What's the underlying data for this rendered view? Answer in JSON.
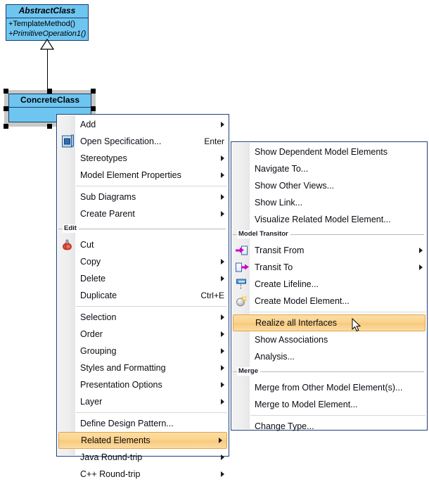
{
  "diagram": {
    "abstract_class": {
      "name": "AbstractClass",
      "operations": [
        "+TemplateMethod()",
        "+PrimitiveOperation1()"
      ]
    },
    "concrete_class": {
      "name": "ConcreteClass",
      "operations": []
    },
    "relationship": "generalization",
    "colors": {
      "class_fill": "#6ec6f0",
      "class_border": "#1b3a6b",
      "selection_frame": "#c8c8c8",
      "handle": "#000000"
    }
  },
  "context_menu": {
    "groups": [
      {
        "label": "",
        "items": [
          {
            "label": "Add",
            "icon": "",
            "accel": "",
            "submenu": true,
            "highlighted": false
          },
          {
            "label": "Open Specification...",
            "icon": "specification-icon",
            "accel": "Enter",
            "submenu": false,
            "highlighted": false
          },
          {
            "label": "Stereotypes",
            "icon": "",
            "accel": "",
            "submenu": true,
            "highlighted": false
          },
          {
            "label": "Model Element Properties",
            "icon": "",
            "accel": "",
            "submenu": true,
            "highlighted": false
          }
        ]
      },
      {
        "label": "",
        "separator_before": true,
        "items": [
          {
            "label": "Sub Diagrams",
            "icon": "",
            "accel": "",
            "submenu": true,
            "highlighted": false
          },
          {
            "label": "Create Parent",
            "icon": "",
            "accel": "",
            "submenu": true,
            "highlighted": false
          }
        ]
      },
      {
        "label": "Edit",
        "items": [
          {
            "label": "Cut",
            "icon": "scissors-icon",
            "accel": "",
            "submenu": false,
            "highlighted": false
          },
          {
            "label": "Copy",
            "icon": "",
            "accel": "",
            "submenu": true,
            "highlighted": false
          },
          {
            "label": "Delete",
            "icon": "",
            "accel": "",
            "submenu": true,
            "highlighted": false
          },
          {
            "label": "Duplicate",
            "icon": "",
            "accel": "Ctrl+E",
            "submenu": false,
            "highlighted": false
          }
        ]
      },
      {
        "label": "",
        "separator_before": true,
        "items": [
          {
            "label": "Selection",
            "icon": "",
            "accel": "",
            "submenu": true,
            "highlighted": false
          },
          {
            "label": "Order",
            "icon": "",
            "accel": "",
            "submenu": true,
            "highlighted": false
          },
          {
            "label": "Grouping",
            "icon": "",
            "accel": "",
            "submenu": true,
            "highlighted": false
          },
          {
            "label": "Styles and Formatting",
            "icon": "",
            "accel": "",
            "submenu": true,
            "highlighted": false
          },
          {
            "label": "Presentation Options",
            "icon": "",
            "accel": "",
            "submenu": true,
            "highlighted": false
          },
          {
            "label": "Layer",
            "icon": "",
            "accel": "",
            "submenu": true,
            "highlighted": false
          }
        ]
      },
      {
        "label": "",
        "separator_before": true,
        "items": [
          {
            "label": "Define Design Pattern...",
            "icon": "",
            "accel": "",
            "submenu": false,
            "highlighted": false
          },
          {
            "label": "Related Elements",
            "icon": "",
            "accel": "",
            "submenu": true,
            "highlighted": true
          },
          {
            "label": "Java Round-trip",
            "icon": "",
            "accel": "",
            "submenu": true,
            "highlighted": false
          },
          {
            "label": "C++ Round-trip",
            "icon": "",
            "accel": "",
            "submenu": true,
            "highlighted": false
          }
        ]
      }
    ]
  },
  "submenu": {
    "groups": [
      {
        "label": "",
        "items": [
          {
            "label": "Show Dependent Model Elements",
            "icon": "",
            "accel": "",
            "submenu": false,
            "highlighted": false
          },
          {
            "label": "Navigate To...",
            "icon": "",
            "accel": "",
            "submenu": false,
            "highlighted": false
          },
          {
            "label": "Show Other Views...",
            "icon": "",
            "accel": "",
            "submenu": false,
            "highlighted": false
          },
          {
            "label": "Show Link...",
            "icon": "",
            "accel": "",
            "submenu": false,
            "highlighted": false
          },
          {
            "label": "Visualize Related Model Element...",
            "icon": "",
            "accel": "",
            "submenu": false,
            "highlighted": false
          }
        ]
      },
      {
        "label": "Model Transitor",
        "items": [
          {
            "label": "Transit From",
            "icon": "transit-from-icon",
            "accel": "",
            "submenu": true,
            "highlighted": false
          },
          {
            "label": "Transit To",
            "icon": "transit-to-icon",
            "accel": "",
            "submenu": true,
            "highlighted": false
          },
          {
            "label": "Create Lifeline...",
            "icon": "lifeline-icon",
            "accel": "",
            "submenu": false,
            "highlighted": false
          },
          {
            "label": "Create Model Element...",
            "icon": "model-element-icon",
            "accel": "",
            "submenu": false,
            "highlighted": false
          }
        ]
      },
      {
        "label": "",
        "separator_before": true,
        "items": [
          {
            "label": "Realize all Interfaces",
            "icon": "",
            "accel": "",
            "submenu": false,
            "highlighted": true
          },
          {
            "label": "Show Associations",
            "icon": "",
            "accel": "",
            "submenu": false,
            "highlighted": false
          },
          {
            "label": "Analysis...",
            "icon": "",
            "accel": "",
            "submenu": false,
            "highlighted": false
          }
        ]
      },
      {
        "label": "Merge",
        "items": [
          {
            "label": "Merge from Other Model Element(s)...",
            "icon": "",
            "accel": "",
            "submenu": false,
            "highlighted": false
          },
          {
            "label": "Merge to Model Element...",
            "icon": "",
            "accel": "",
            "submenu": false,
            "highlighted": false
          }
        ]
      },
      {
        "label": "",
        "separator_before": true,
        "items": [
          {
            "label": "Change Type...",
            "icon": "",
            "accel": "",
            "submenu": false,
            "highlighted": false
          }
        ]
      }
    ]
  },
  "theme": {
    "menu_border": "#1f3f7a",
    "menu_bg": "#ffffff",
    "highlight_fill": "#fbd28a",
    "highlight_border": "#e3a24a",
    "gutter": "#eeeeee"
  }
}
